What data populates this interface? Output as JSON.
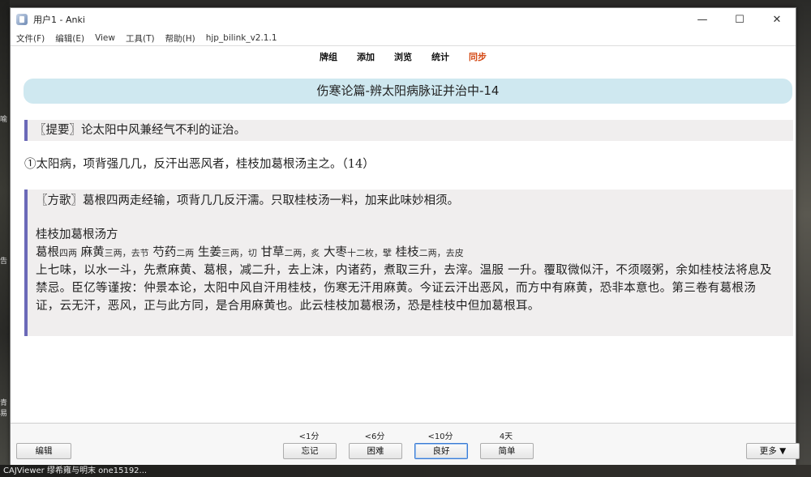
{
  "window": {
    "title": "用户1 - Anki",
    "min": "—",
    "max": "☐",
    "close": "✕"
  },
  "menu": [
    "文件(F)",
    "编辑(E)",
    "View",
    "工具(T)",
    "帮助(H)",
    "hjp_bilink_v2.1.1"
  ],
  "toolbar": {
    "decks": "牌组",
    "add": "添加",
    "browse": "浏览",
    "stats": "统计",
    "sync": "同步",
    "sync_color": "#d44a16"
  },
  "card": {
    "deck_title": "伤寒论篇-辨太阳病脉证并治中-14",
    "tiyao": "〖提要〗论太阳中风兼经气不利的证治。",
    "verse": "①太阳病，项背强几几，反汗出恶风者，桂枝加葛根汤主之。（14）",
    "fange": "〖方歌〗葛根四两走经输，项背几几反汗濡。只取桂枝汤一料，加来此味妙相须。",
    "formula_name": "桂枝加葛根汤方",
    "herbs": [
      {
        "name": "葛根",
        "dose": "四两"
      },
      {
        "name": "麻黄",
        "dose": "三两，去节"
      },
      {
        "name": "芍药",
        "dose": "二两"
      },
      {
        "name": "生姜",
        "dose": "三两，切"
      },
      {
        "name": "甘草",
        "dose": "二两，炙"
      },
      {
        "name": "大枣",
        "dose": "十二枚，擘"
      },
      {
        "name": "桂枝",
        "dose": "二两，去皮"
      }
    ],
    "instructions": "上七味，以水一斗，先煮麻黄、葛根，减二升，去上沫，内诸药，煮取三升，去滓。温服 一升。覆取微似汗，不须啜粥，余如桂枝法将息及禁忌。臣亿等谨按：仲景本论，太阳中风自汗用桂枝，伤寒无汗用麻黄。今证云汗出恶风，而方中有麻黄，恐非本意也。第三卷有葛根汤证，云无汗，恶风，正与此方同，是合用麻黄也。此云桂枝加葛根汤，恐是桂枝中但加葛根耳。"
  },
  "bottom": {
    "edit": "编辑",
    "more": "更多 ▼",
    "ease": [
      {
        "interval": "<1分",
        "label": "忘记"
      },
      {
        "interval": "<6分",
        "label": "困难"
      },
      {
        "interval": "<10分",
        "label": "良好"
      },
      {
        "interval": "4天",
        "label": "简单"
      }
    ]
  },
  "desktop": {
    "frag1": "喻",
    "frag2": "告",
    "frag3": "青",
    "frag4": "易"
  },
  "taskbar": "CAJViewer  缪希雍与明末  one15192..."
}
